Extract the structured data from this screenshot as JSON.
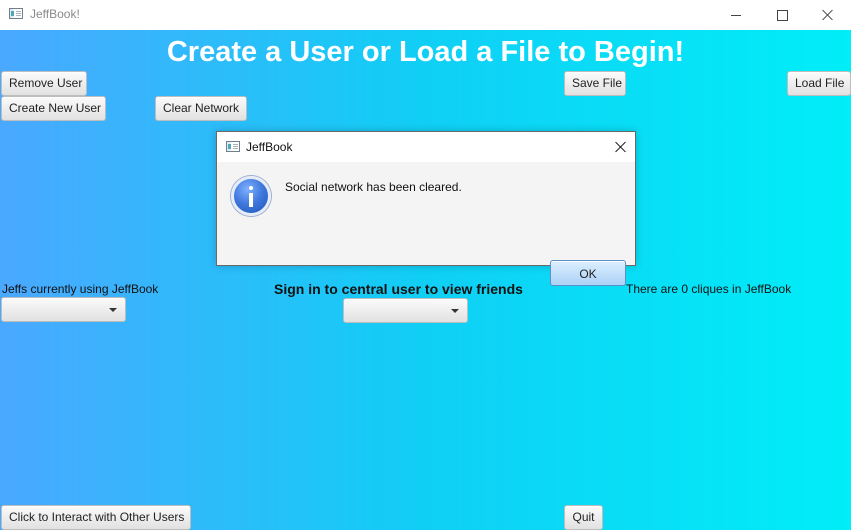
{
  "window": {
    "title": "JeffBook!",
    "controls": {
      "minimize_icon": "minimize-icon",
      "maximize_icon": "maximize-icon",
      "close_icon": "close-icon"
    }
  },
  "main": {
    "title": "Create a User or Load a File to Begin!",
    "buttons": {
      "remove_user": "Remove User",
      "create_new_user": "Create New User",
      "clear_network": "Clear Network",
      "save_file": "Save File",
      "load_file": "Load File",
      "interact_users": "Click to Interact with Other Users",
      "quit": "Quit"
    },
    "labels": {
      "current_users": "Jeffs currently using JeffBook",
      "central_user": "Sign in to central user to view friends",
      "cliques": "There are 0 cliques in JeffBook"
    },
    "dropdowns": {
      "current_users_selected": "",
      "central_user_selected": ""
    }
  },
  "dialog": {
    "title": "JeffBook",
    "icon": "information-icon",
    "message": "Social network has been cleared.",
    "ok_label": "OK"
  },
  "colors": {
    "background_left": "#4aa8ff",
    "background_right": "#00eef8",
    "title_text": "#ffffff",
    "dialog_background": "#f4f4f4",
    "ok_button_blue": "#acd2f7",
    "info_icon_blue": "#3f77dc"
  }
}
